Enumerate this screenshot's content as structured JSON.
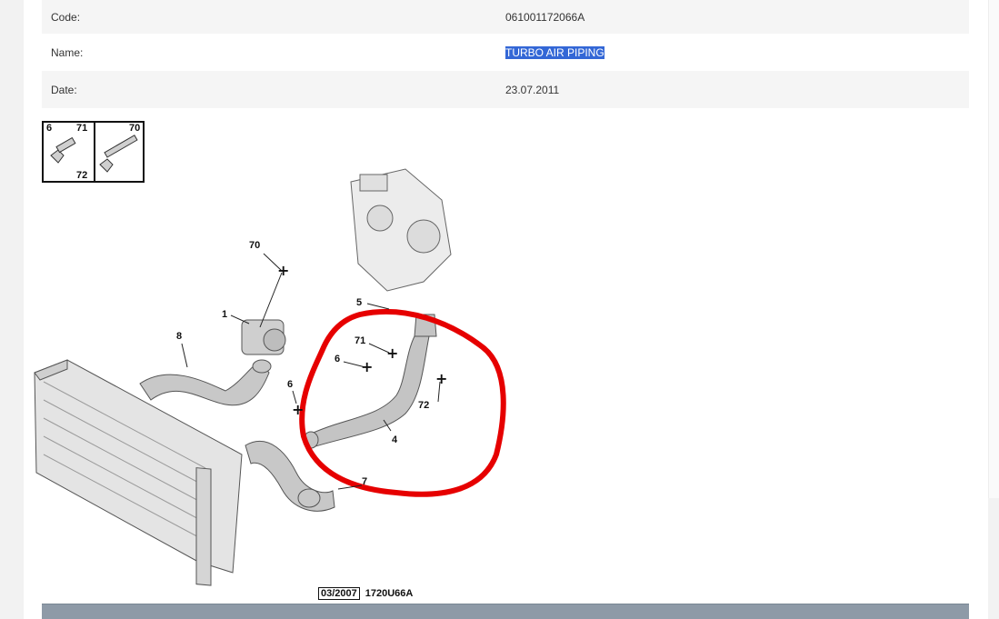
{
  "details": {
    "code_label": "Code:",
    "code_value": "061001172066A",
    "name_label": "Name:",
    "name_value": "TURBO AIR PIPING",
    "date_label": "Date:",
    "date_value": "23.07.2011"
  },
  "fastener_legend": {
    "label_6": "6",
    "label_71": "71",
    "label_72": "72",
    "label_70": "70"
  },
  "diagram": {
    "callouts": {
      "c70": "70",
      "c1": "1",
      "c8": "8",
      "c5": "5",
      "c71": "71",
      "c6a": "6",
      "c6b": "6",
      "c72": "72",
      "c4": "4",
      "c7": "7"
    },
    "reference_date": "03/2007",
    "reference_code": "1720U66A",
    "annotation_color": "#e60000"
  }
}
